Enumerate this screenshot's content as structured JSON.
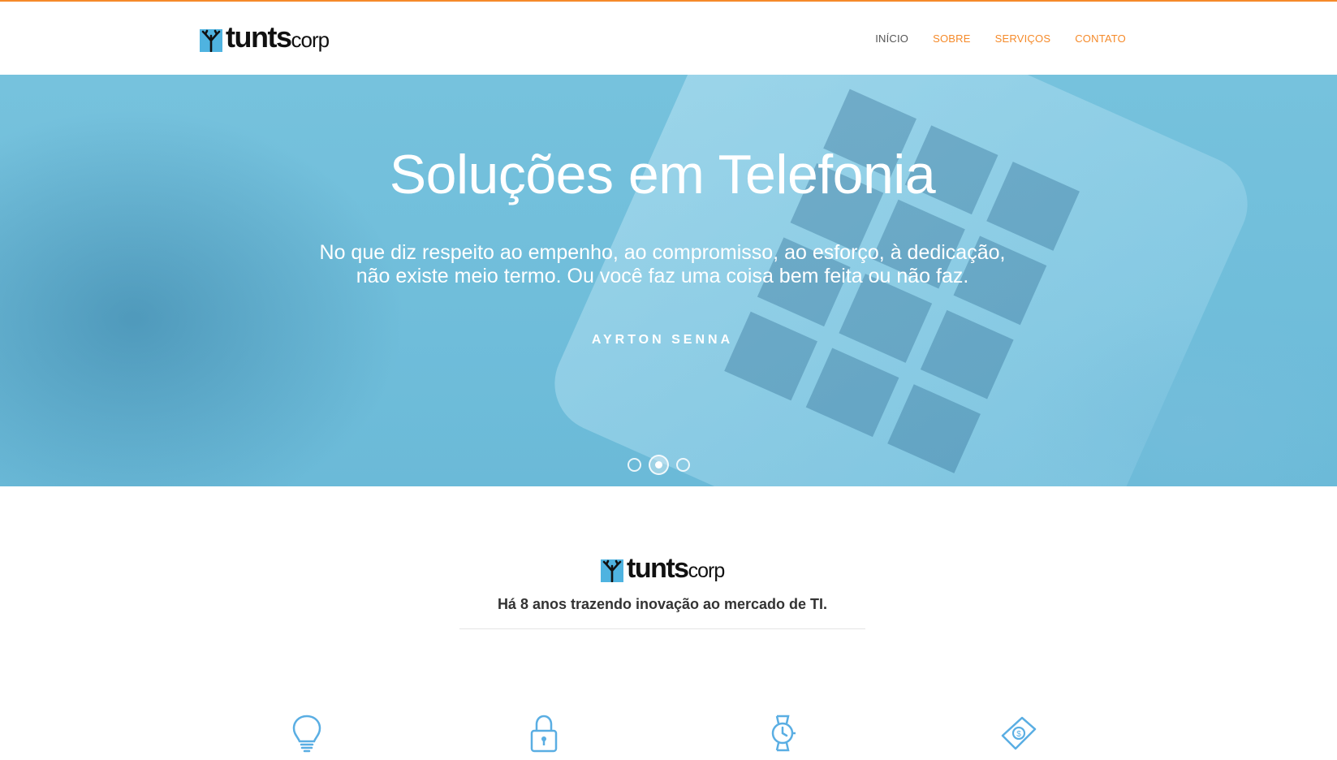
{
  "brand": {
    "main": "tunts",
    "sub": "corp"
  },
  "nav": [
    {
      "label": "INÍCIO",
      "active": true
    },
    {
      "label": "SOBRE",
      "active": false
    },
    {
      "label": "SERVIÇOS",
      "active": false
    },
    {
      "label": "CONTATO",
      "active": false
    }
  ],
  "hero": {
    "title": "Soluções em Telefonia",
    "quote_line1": "No que diz respeito ao empenho, ao compromisso, ao esforço, à dedicação,",
    "quote_line2": "não existe meio termo. Ou você faz uma coisa bem feita ou não faz.",
    "author": "AYRTON SENNA",
    "slides": 3,
    "active_slide": 2
  },
  "about": {
    "tagline": "Há 8 anos trazendo inovação ao mercado de TI."
  },
  "features": {
    "icons": [
      "lightbulb-icon",
      "lock-icon",
      "watch-icon",
      "money-bill-icon"
    ]
  },
  "colors": {
    "accent": "#f58a2a",
    "hero_overlay": "#6bbad8",
    "brand_blue": "#4fb3e0",
    "icon_blue": "#5aaee3"
  }
}
